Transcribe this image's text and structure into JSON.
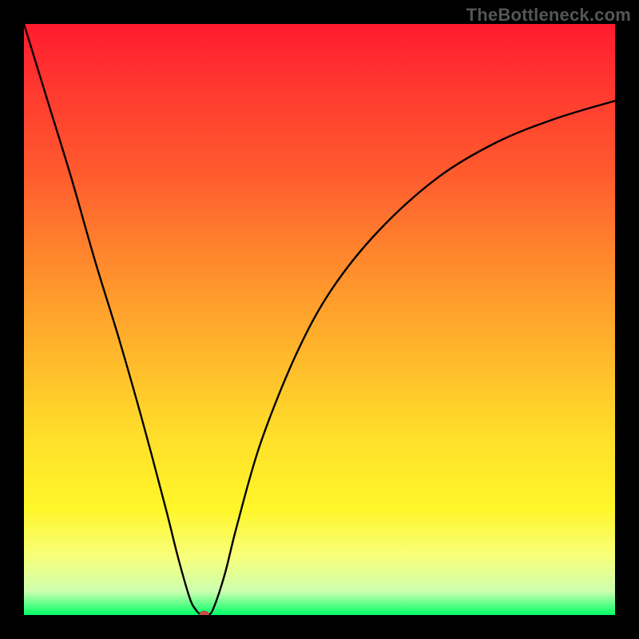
{
  "watermark": "TheBottleneck.com",
  "chart_data": {
    "type": "line",
    "title": "",
    "xlabel": "",
    "ylabel": "",
    "xlim": [
      0,
      100
    ],
    "ylim": [
      0,
      100
    ],
    "background_gradient": {
      "top_color": "#ff1b2f",
      "bottom_color": "#00ff66",
      "description": "red-to-green vertical gradient (red=high bottleneck, green=low)"
    },
    "series": [
      {
        "name": "bottleneck-curve",
        "color": "#000000",
        "x": [
          0,
          4,
          8,
          12,
          16,
          20,
          24,
          26,
          28,
          29,
          30,
          31,
          32,
          34,
          36,
          40,
          46,
          52,
          60,
          70,
          80,
          90,
          100
        ],
        "y": [
          100,
          87,
          74,
          60,
          47,
          33,
          18,
          10,
          3,
          1,
          0,
          0,
          1,
          7,
          15,
          29,
          44,
          55,
          65,
          74,
          80,
          84,
          87
        ]
      }
    ],
    "marker": {
      "name": "minimum-point",
      "x": 30.5,
      "y": 0,
      "color": "#cc4a4a",
      "rx": 6,
      "ry": 5
    }
  }
}
